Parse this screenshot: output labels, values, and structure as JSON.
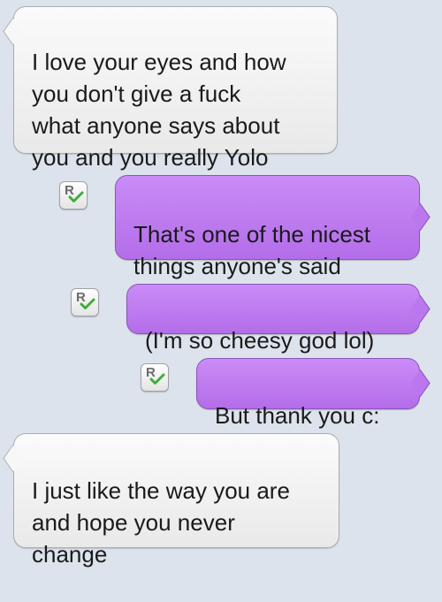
{
  "messages": [
    {
      "direction": "received",
      "text": "I love your eyes and how\nyou don't give a fuck\nwhat anyone says about\nyou and you really Yolo"
    },
    {
      "direction": "sent",
      "text": "That's one of the nicest\nthings anyone's said",
      "receipt": "R"
    },
    {
      "direction": "sent",
      "text": "(I'm so cheesy god lol)",
      "receipt": "R"
    },
    {
      "direction": "sent",
      "text": "But thank you c:",
      "receipt": "R"
    },
    {
      "direction": "received",
      "text": "I just like the way you are\nand hope you never\nchange"
    }
  ],
  "colors": {
    "background": "#dde3ec",
    "received_bubble": "#f4f4f4",
    "sent_bubble": "#bf7df0",
    "receipt_check": "#3fae3a"
  },
  "icons": {
    "read_receipt": "read-receipt-icon"
  }
}
